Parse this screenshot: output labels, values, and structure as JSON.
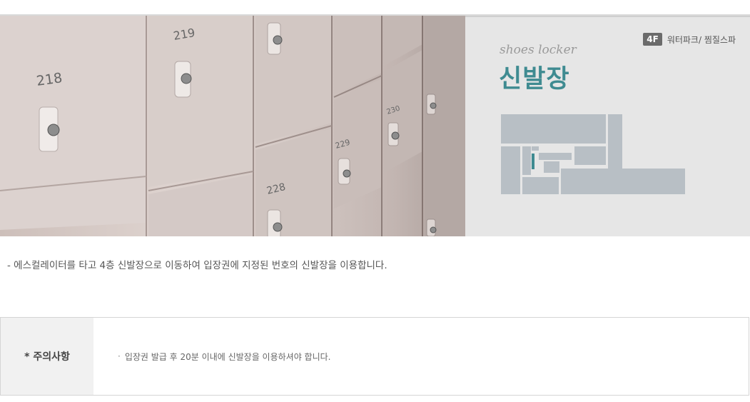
{
  "hero": {
    "photo": {
      "alt": "shoes locker photo",
      "locker_numbers": [
        "218",
        "219",
        "228",
        "229",
        "230"
      ]
    },
    "floor_badge": "4F",
    "floor_text": "워터파크/ 찜질스파",
    "title_en": "shoes locker",
    "title_ko": "신발장",
    "accent_color": "#3f8b91"
  },
  "description": "-  에스컬레이터를 타고 4층 신발장으로 이동하여 입장권에 지정된 번호의 신발장을 이용합니다.",
  "notice": {
    "header": "* 주의사항",
    "bullet": "·",
    "item": "입장권 발급 후 20분 이내에 신발장을 이용하셔야 합니다."
  }
}
